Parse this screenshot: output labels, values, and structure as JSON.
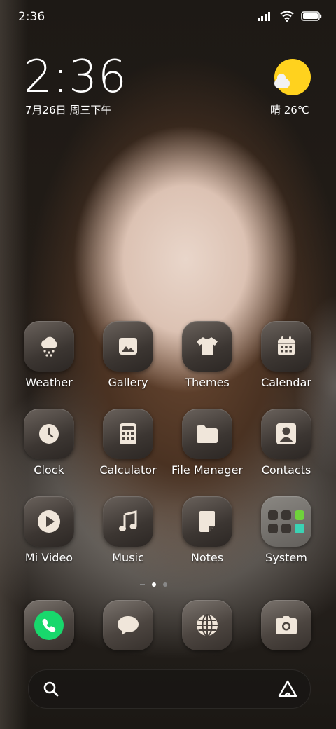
{
  "status_bar": {
    "time": "2:36",
    "signal_icon": "signal-icon",
    "wifi_icon": "wifi-icon",
    "battery_icon": "battery-icon"
  },
  "clock_widget": {
    "time": "2:36",
    "date": "7月26日 周三下午"
  },
  "weather_widget": {
    "icon": "sunny-cloud-icon",
    "text": "晴 26℃"
  },
  "apps": [
    {
      "label": "Weather",
      "icon": "weather-icon"
    },
    {
      "label": "Gallery",
      "icon": "gallery-icon"
    },
    {
      "label": "Themes",
      "icon": "themes-icon"
    },
    {
      "label": "Calendar",
      "icon": "calendar-icon"
    },
    {
      "label": "Clock",
      "icon": "clock-icon"
    },
    {
      "label": "Calculator",
      "icon": "calculator-icon"
    },
    {
      "label": "File Manager",
      "icon": "folder-icon"
    },
    {
      "label": "Contacts",
      "icon": "contacts-icon"
    },
    {
      "label": "Mi Video",
      "icon": "play-icon"
    },
    {
      "label": "Music",
      "icon": "music-icon"
    },
    {
      "label": "Notes",
      "icon": "notes-icon"
    },
    {
      "label": "System",
      "icon": "folder-group-icon"
    }
  ],
  "page_indicator": {
    "current_page": 1,
    "total_pages": 2
  },
  "dock": [
    {
      "name": "Phone",
      "icon": "phone-icon"
    },
    {
      "name": "Messages",
      "icon": "message-icon"
    },
    {
      "name": "Browser",
      "icon": "globe-icon"
    },
    {
      "name": "Camera",
      "icon": "camera-icon"
    }
  ],
  "search_bar": {
    "search_icon": "search-icon",
    "assistant_icon": "assistant-icon"
  },
  "colors": {
    "phone_green": "#18d86c",
    "sun_yellow": "#ffd21e",
    "icon_fg": "#f0e6da"
  }
}
